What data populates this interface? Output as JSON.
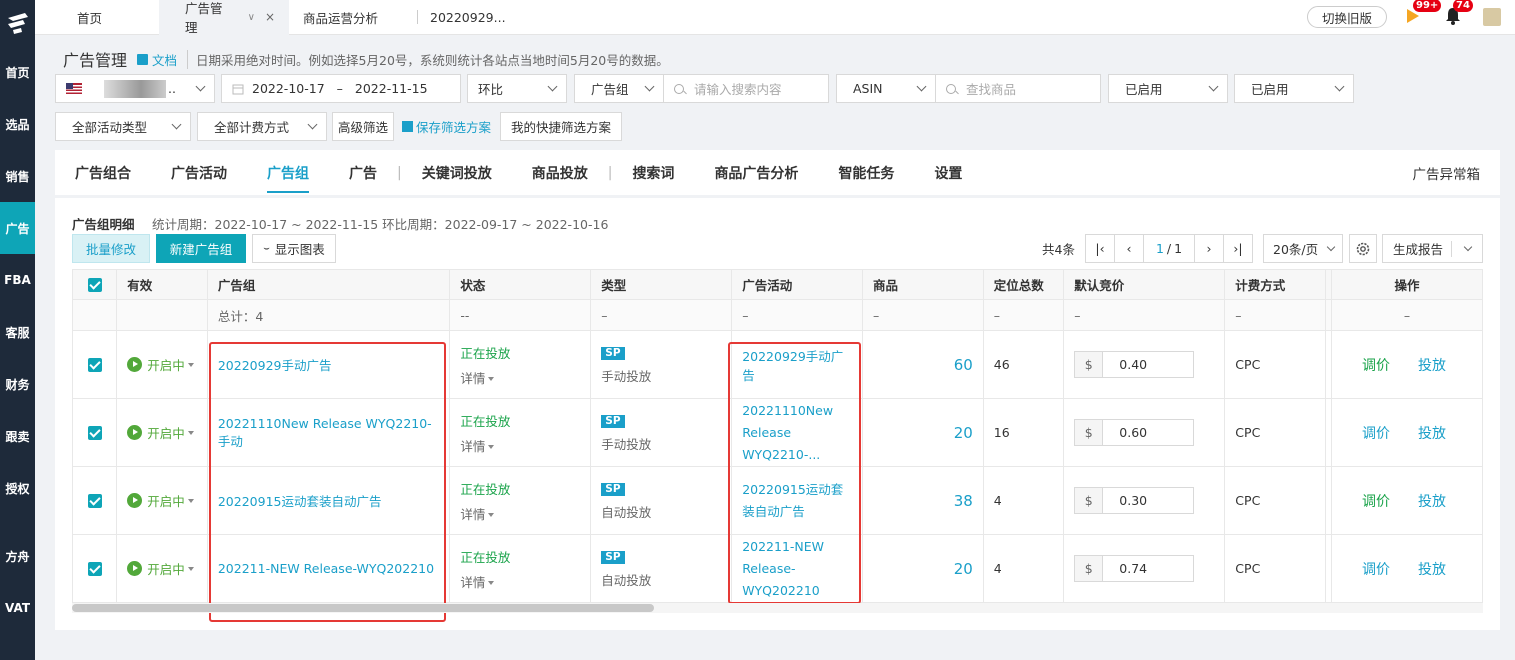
{
  "sidebar": {
    "items": [
      {
        "label": "首页"
      },
      {
        "label": "选品"
      },
      {
        "label": "销售"
      },
      {
        "label": "广告"
      },
      {
        "label": "FBA"
      },
      {
        "label": "客服"
      },
      {
        "label": "财务"
      },
      {
        "label": "跟卖"
      },
      {
        "label": "授权"
      },
      {
        "label": "方舟"
      },
      {
        "label": "VAT"
      }
    ],
    "active_index": 3
  },
  "topbar": {
    "tabs": [
      {
        "label": "首页"
      },
      {
        "label": "广告管理"
      },
      {
        "label": "商品运营分析"
      },
      {
        "label": "20220929..."
      }
    ],
    "close_glyph": "×",
    "chev_glyph": "∨",
    "switch_label": "切换旧版",
    "flag_badge": "99+",
    "bell_badge": "74"
  },
  "page": {
    "title": "广告管理",
    "doc_label": "文档",
    "hint": "日期采用绝对时间。例如选择5月20号，系统则统计各站点当地时间5月20号的数据。"
  },
  "filters": {
    "date_start": "2022-10-17",
    "date_dash": "–",
    "date_end": "2022-11-15",
    "compare": "环比",
    "group_select": "广告组",
    "search_placeholder": "请输入搜索内容",
    "asin_select": "ASIN",
    "goods_placeholder": "查找商品",
    "enabled1": "已启用",
    "enabled2": "已启用",
    "activity_type": "全部活动类型",
    "billing_type": "全部计费方式",
    "advanced": "高级筛选",
    "save_scheme": "保存筛选方案",
    "my_scheme": "我的快捷筛选方案"
  },
  "tabs": {
    "items": [
      "广告组合",
      "广告活动",
      "广告组",
      "广告",
      "关键词投放",
      "商品投放",
      "搜索词",
      "商品广告分析",
      "智能任务",
      "设置"
    ],
    "separators": [
      "|",
      "|"
    ],
    "active": "广告组",
    "right": "广告异常箱"
  },
  "content": {
    "section_title": "广告组明细",
    "period": "统计周期：2022-10-17 ~ 2022-11-15 环比周期：2022-09-17 ~ 2022-10-16",
    "batch_edit": "批量修改",
    "new_group": "新建广告组",
    "show_chart": "显示图表",
    "total_count": "共4条",
    "page_current": "1",
    "page_sep": "/",
    "page_total": "1",
    "page_size": "20条/页",
    "report": "生成报告"
  },
  "table": {
    "headers": [
      "有效",
      "广告组",
      "状态",
      "类型",
      "广告活动",
      "商品",
      "定位总数",
      "默认竞价",
      "计费方式",
      "操作"
    ],
    "total_row": {
      "group": "总计：4",
      "status": "--",
      "dash": "–"
    },
    "detail_label": "详情",
    "status_on": "开启中",
    "running": "正在投放",
    "currency": "$",
    "op_adjust": "调价",
    "op_launch": "投放",
    "rows": [
      {
        "group": "20220929手动广告",
        "type_badge": "SP",
        "type_text": "手动投放",
        "campaign": "20220929手动广告",
        "goods": "60",
        "targets": "46",
        "bid": "0.40",
        "billing": "CPC"
      },
      {
        "group": "20221110New Release WYQ2210-手动",
        "type_badge": "SP",
        "type_text": "手动投放",
        "campaign": "20221110New Release WYQ2210-...",
        "goods": "20",
        "targets": "16",
        "bid": "0.60",
        "billing": "CPC"
      },
      {
        "group": "20220915运动套装自动广告",
        "type_badge": "SP",
        "type_text": "自动投放",
        "campaign": "20220915运动套装自动广告",
        "goods": "38",
        "targets": "4",
        "bid": "0.30",
        "billing": "CPC"
      },
      {
        "group": "202211-NEW Release-WYQ202210",
        "type_badge": "SP",
        "type_text": "自动投放",
        "campaign": "202211-NEW Release-WYQ202210",
        "goods": "20",
        "targets": "4",
        "bid": "0.74",
        "billing": "CPC"
      }
    ]
  },
  "colors": {
    "accent": "#0ea5b7",
    "link": "#1a9fc9",
    "green": "#52a83a",
    "annotation": "#e53935"
  }
}
